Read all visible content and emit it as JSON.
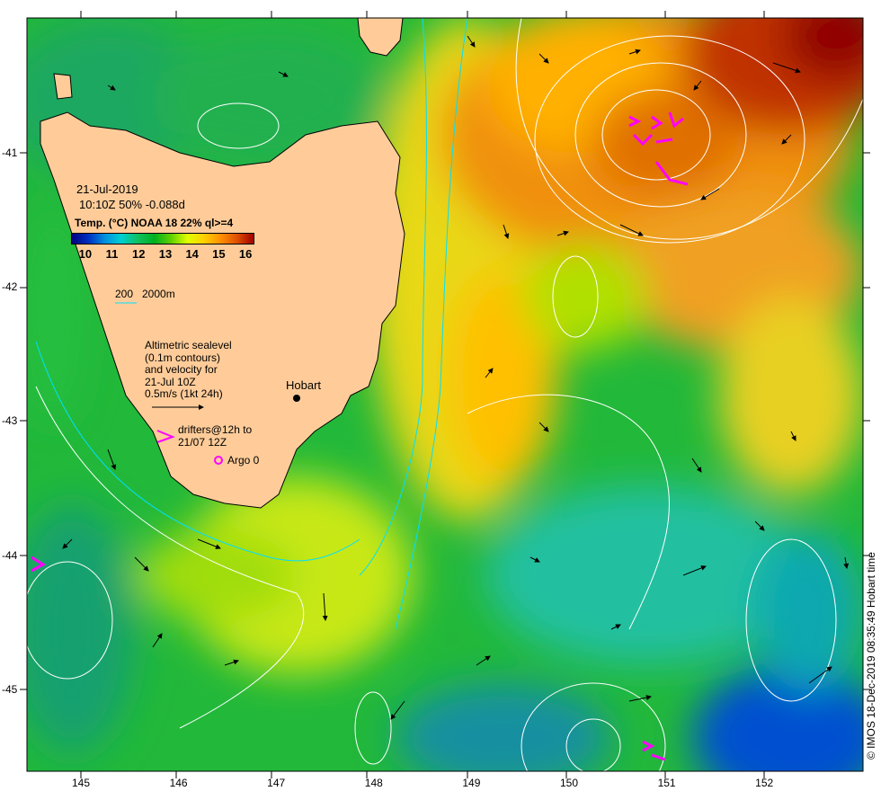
{
  "header": {
    "date": "21-Jul-2019",
    "time_line": "10:10Z  50% -0.088d",
    "sensor_line": "Temp. (°C) NOAA 18 22% ql>=4"
  },
  "colorbar": {
    "ticks": [
      "10",
      "11",
      "12",
      "13",
      "14",
      "15",
      "16"
    ],
    "range": [
      9.5,
      16.3
    ],
    "colors": [
      "#00007f",
      "#0030c0",
      "#0090e0",
      "#00d0d0",
      "#10c060",
      "#00b020",
      "#60d000",
      "#e0ff00",
      "#ffd000",
      "#ff9000",
      "#e05000",
      "#a00000"
    ]
  },
  "legend": {
    "isobath_a": "200",
    "isobath_b": "2000m",
    "sealevel_lines": [
      "Altimetric sealevel",
      "(0.1m contours)",
      "and velocity for",
      "21-Jul 10Z",
      "0.5m/s (1kt 24h)"
    ],
    "drifters_lines": [
      "drifters@12h to",
      "21/07 12Z"
    ],
    "argo": "Argo 0"
  },
  "places": {
    "hobart": "Hobart"
  },
  "axes": {
    "lon_ticks": [
      "145",
      "146",
      "147",
      "148",
      "149",
      "150",
      "151",
      "152"
    ],
    "lat_ticks": [
      "-41",
      "-42",
      "-43",
      "-44",
      "-45"
    ]
  },
  "credit": "© IMOS 18-Dec-2019 08:35:49 Hobart time",
  "colors": {
    "land": "#ffcc99",
    "drifter": "#ff00ff",
    "isobath": "#00e0ff",
    "contour": "#ffffff"
  }
}
